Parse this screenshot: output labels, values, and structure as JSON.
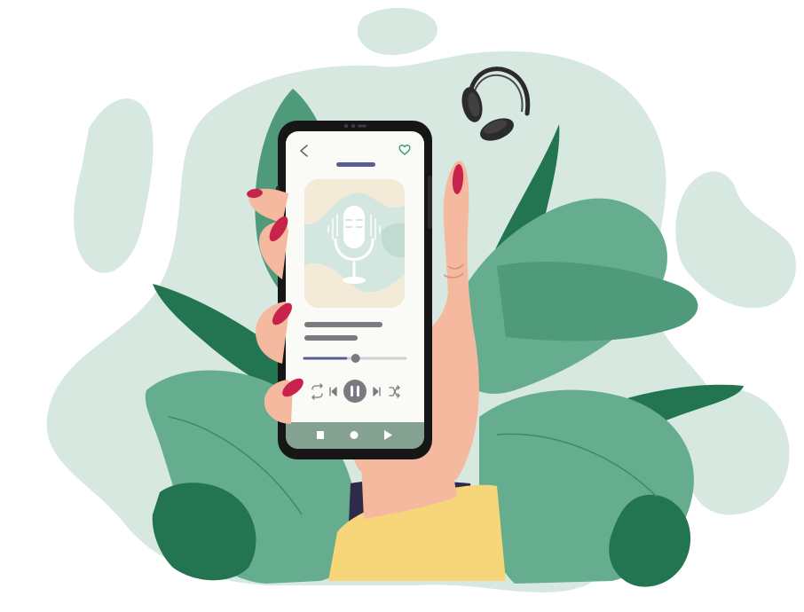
{
  "scene": {
    "title": "",
    "colors": {
      "blob": "#d6e8e0",
      "leaf_dark": "#237451",
      "leaf_mid": "#4e9a7a",
      "leaf_light": "#66ad8f",
      "skin": "#f5b9a0",
      "skin_shadow": "#e8a58a",
      "nail": "#c8234b",
      "sleeve": "#f7d67a",
      "sleeve_cuff": "#2d2a4a",
      "phone_body": "#161616",
      "screen_bg": "#fafaf6",
      "art_bg": "#d3e7e0",
      "art_cream": "#f4ead8",
      "accent_indigo": "#5a5c94",
      "control_grey": "#7b7a80",
      "nav_bar": "#84a191",
      "headphones": "#2b2b2b"
    }
  },
  "phone": {
    "screen": {
      "back_icon": "chevron-left-icon",
      "favorite_icon": "heart-icon",
      "cover_icon": "microphone-icon",
      "progress": 0.48,
      "controls": [
        "repeat-icon",
        "previous-icon",
        "pause-icon",
        "next-icon",
        "shuffle-icon"
      ],
      "nav_icons": [
        "stop-icon",
        "home-dot-icon",
        "play-icon"
      ]
    }
  },
  "accessory_icon": "headphones-icon"
}
